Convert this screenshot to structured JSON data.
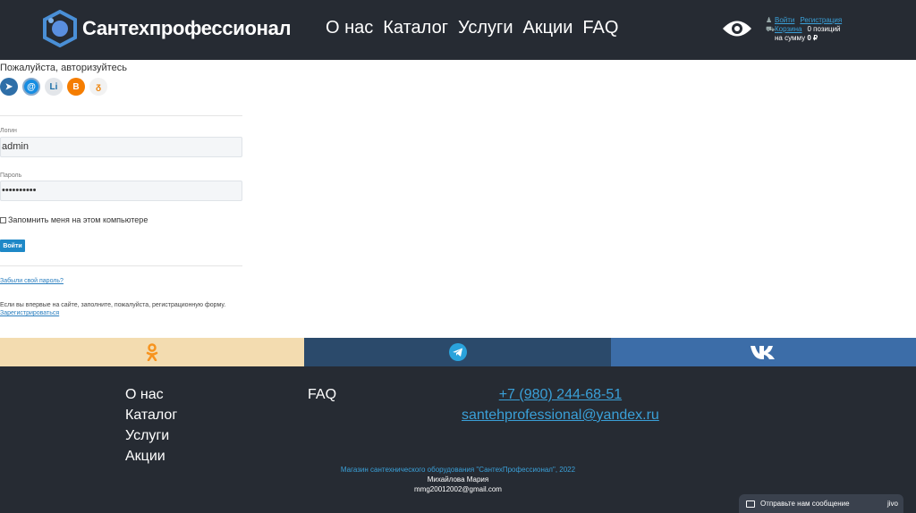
{
  "header": {
    "brand": "Сантехпрофессионал",
    "nav": [
      "О нас",
      "Каталог",
      "Услуги",
      "Акции",
      "FAQ"
    ],
    "user": {
      "login": "Войти",
      "register": "Регистрация",
      "cart": "Корзина",
      "positions": "0 позиций",
      "sum_label": "на сумму",
      "sum_value": "0 ₽"
    }
  },
  "auth": {
    "title": "Пожалуйста, авторизуйтесь",
    "social": [
      "vk",
      "mail",
      "li",
      "blogger",
      "ok"
    ],
    "login_label": "Логин",
    "login_value": "admin",
    "password_label": "Пароль",
    "password_value": "••••••••••",
    "remember": "Запомнить меня на этом компьютере",
    "submit": "Войти",
    "forgot": "Забыли свой пароль?",
    "note": "Если вы впервые на сайте, заполните, пожалуйста, регистрационную форму.",
    "register_link": "Зарегистрироваться"
  },
  "footer": {
    "col1": [
      "О нас",
      "Каталог",
      "Услуги",
      "Акции"
    ],
    "col2": [
      "FAQ"
    ],
    "phone": "+7 (980) 244-68-51",
    "email": "santehprofessional@yandex.ru",
    "copyright": "Магазин сантехнического оборудования \"СантехПрофессионал\", 2022",
    "author": "Михайлова Мария",
    "author_email": "mmg20012002@gmail.com"
  },
  "chat": {
    "label": "Отправьте нам сообщение",
    "brand": "jivo"
  },
  "colors": {
    "header_bg": "#262b33",
    "accent": "#3aa0d8",
    "ok": "#f3dcb0",
    "telegram": "#2b4a6b",
    "vk": "#3c6da8"
  }
}
